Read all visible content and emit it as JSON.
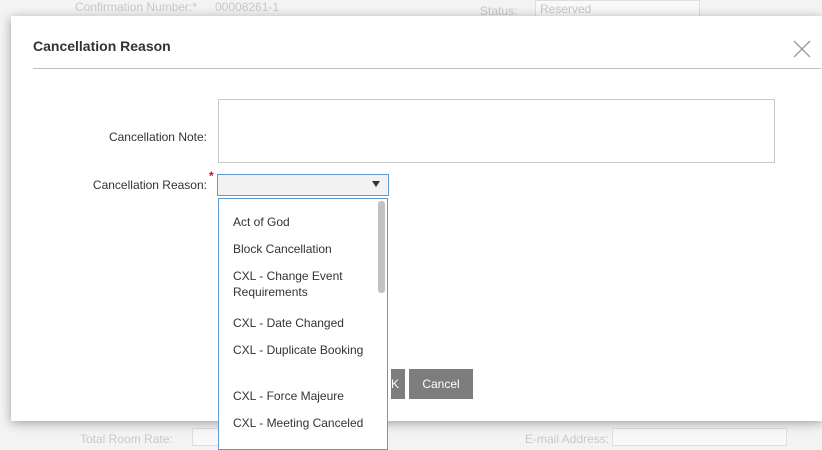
{
  "background": {
    "confirmation_label": "Confirmation Number:*",
    "confirmation_value": "00008261-1",
    "status_label": "Status:",
    "status_value": "Reserved",
    "total_room_rate_label": "Total Room Rate:",
    "email_label": "E-mail Address:"
  },
  "modal": {
    "title": "Cancellation Reason",
    "note_label": "Cancellation Note:",
    "note_value": "",
    "reason_label": "Cancellation Reason:",
    "reason_value": "",
    "required_marker": "*",
    "ok_label_partial": "K",
    "cancel_label": "Cancel"
  },
  "dropdown": {
    "options": [
      "Act of God",
      "Block Cancellation",
      "CXL - Change Event Requirements",
      "CXL - Date Changed",
      "CXL - Duplicate Booking",
      "CXL - Force Majeure",
      "CXL - Meeting Canceled"
    ]
  },
  "colors": {
    "accent_border": "#5b9bd5",
    "required": "#d0021b",
    "button_bg": "#7d7d7d"
  },
  "icons": {
    "close": "close-icon",
    "caret": "chevron-down-icon"
  }
}
